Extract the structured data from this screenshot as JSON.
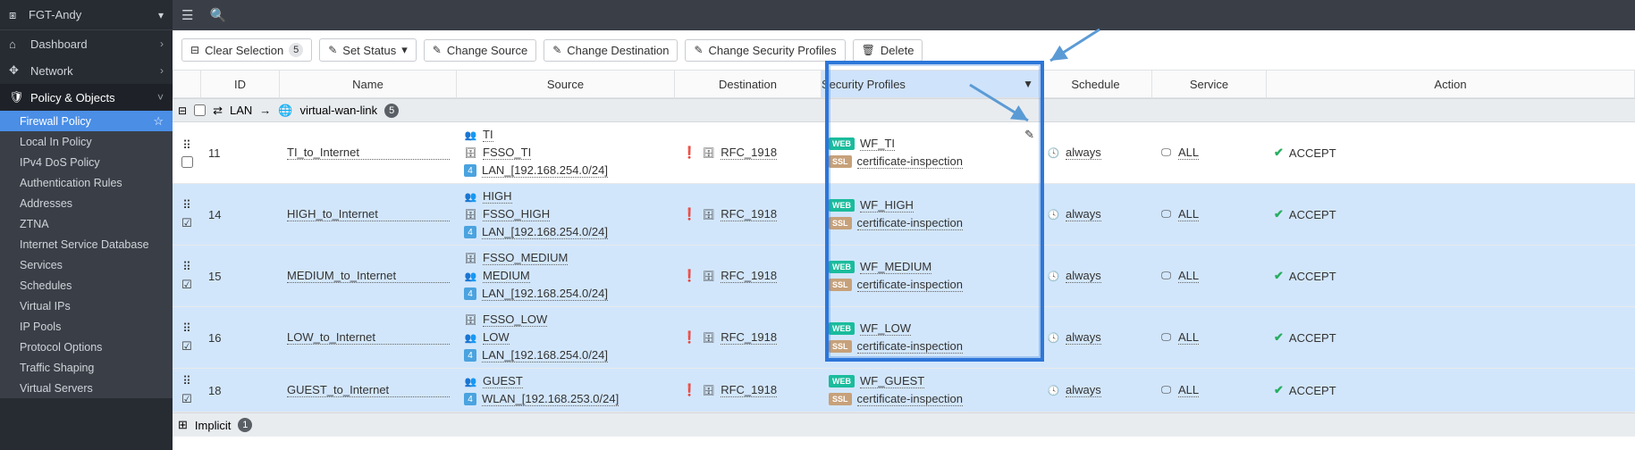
{
  "sidebar": {
    "host": "FGT-Andy",
    "items": [
      {
        "icon": "⌂",
        "label": "Dashboard",
        "caret": "›"
      },
      {
        "icon": "✥",
        "label": "Network",
        "caret": "›"
      },
      {
        "icon": "🛡",
        "label": "Policy & Objects",
        "caret": "˅",
        "open": true
      }
    ],
    "sub": [
      "Firewall Policy",
      "Local In Policy",
      "IPv4 DoS Policy",
      "Authentication Rules",
      "Addresses",
      "ZTNA",
      "Internet Service Database",
      "Services",
      "Schedules",
      "Virtual IPs",
      "IP Pools",
      "Protocol Options",
      "Traffic Shaping",
      "Virtual Servers"
    ]
  },
  "toolbar": {
    "clear": "Clear Selection",
    "clear_count": "5",
    "set_status": "Set Status",
    "change_source": "Change Source",
    "change_dest": "Change Destination",
    "change_sec": "Change Security Profiles",
    "delete": "Delete"
  },
  "columns": {
    "id": "ID",
    "name": "Name",
    "source": "Source",
    "dest": "Destination",
    "sec": "Security Profiles",
    "sched": "Schedule",
    "svc": "Service",
    "act": "Action"
  },
  "group": {
    "from": "LAN",
    "to": "virtual-wan-link",
    "count": "5"
  },
  "rows": [
    {
      "id": "11",
      "name": "TI_to_Internet",
      "sel": false,
      "src": [
        {
          "ico": "grp",
          "txt": "TI"
        },
        {
          "ico": "fsso",
          "txt": "FSSO_TI"
        },
        {
          "ico": "num",
          "txt": "LAN_[192.168.254.0/24]"
        }
      ],
      "dst": "RFC_1918",
      "sec": [
        {
          "tag": "WEB",
          "txt": "WF_TI"
        },
        {
          "tag": "SSL",
          "txt": "certificate-inspection"
        }
      ],
      "sched": "always",
      "svc": "ALL",
      "act": "ACCEPT"
    },
    {
      "id": "14",
      "name": "HIGH_to_Internet",
      "sel": true,
      "src": [
        {
          "ico": "grp",
          "txt": "HIGH"
        },
        {
          "ico": "fsso",
          "txt": "FSSO_HIGH"
        },
        {
          "ico": "num",
          "txt": "LAN_[192.168.254.0/24]"
        }
      ],
      "dst": "RFC_1918",
      "sec": [
        {
          "tag": "WEB",
          "txt": "WF_HIGH"
        },
        {
          "tag": "SSL",
          "txt": "certificate-inspection"
        }
      ],
      "sched": "always",
      "svc": "ALL",
      "act": "ACCEPT"
    },
    {
      "id": "15",
      "name": "MEDIUM_to_Internet",
      "sel": true,
      "src": [
        {
          "ico": "fsso",
          "txt": "FSSO_MEDIUM"
        },
        {
          "ico": "grp",
          "txt": "MEDIUM"
        },
        {
          "ico": "num",
          "txt": "LAN_[192.168.254.0/24]"
        }
      ],
      "dst": "RFC_1918",
      "sec": [
        {
          "tag": "WEB",
          "txt": "WF_MEDIUM"
        },
        {
          "tag": "SSL",
          "txt": "certificate-inspection"
        }
      ],
      "sched": "always",
      "svc": "ALL",
      "act": "ACCEPT"
    },
    {
      "id": "16",
      "name": "LOW_to_Internet",
      "sel": true,
      "src": [
        {
          "ico": "fsso",
          "txt": "FSSO_LOW"
        },
        {
          "ico": "grp",
          "txt": "LOW"
        },
        {
          "ico": "num",
          "txt": "LAN_[192.168.254.0/24]"
        }
      ],
      "dst": "RFC_1918",
      "sec": [
        {
          "tag": "WEB",
          "txt": "WF_LOW"
        },
        {
          "tag": "SSL",
          "txt": "certificate-inspection"
        }
      ],
      "sched": "always",
      "svc": "ALL",
      "act": "ACCEPT"
    },
    {
      "id": "18",
      "name": "GUEST_to_Internet",
      "sel": true,
      "src": [
        {
          "ico": "grp",
          "txt": "GUEST"
        },
        {
          "ico": "num",
          "txt": "WLAN_[192.168.253.0/24]"
        }
      ],
      "dst": "RFC_1918",
      "sec": [
        {
          "tag": "WEB",
          "txt": "WF_GUEST"
        },
        {
          "tag": "SSL",
          "txt": "certificate-inspection"
        }
      ],
      "sched": "always",
      "svc": "ALL",
      "act": "ACCEPT"
    }
  ],
  "implicit": {
    "label": "Implicit",
    "count": "1"
  }
}
